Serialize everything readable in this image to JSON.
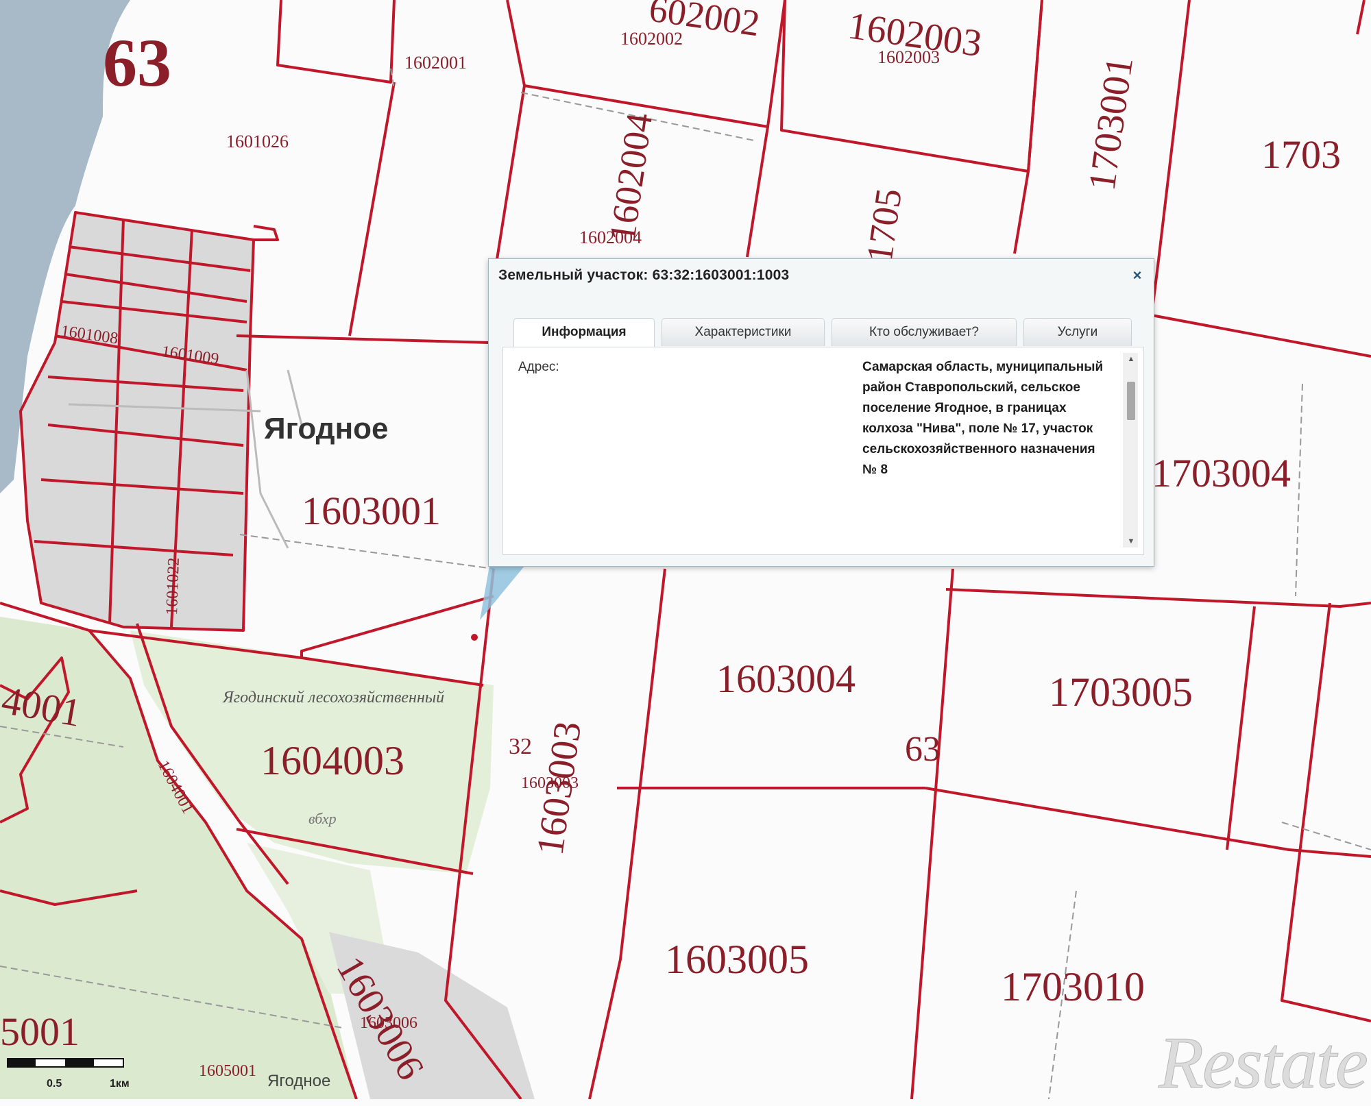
{
  "map": {
    "region_labels": [
      "63",
      "63"
    ],
    "block_labels_large": [
      "1603001",
      "1603004",
      "1703005",
      "1604003",
      "1603005",
      "1703010",
      "1703004",
      "1602003",
      "1703001",
      "1603003",
      "1603006",
      "1602004",
      "1705",
      "602002",
      "1703",
      "4001",
      "5001"
    ],
    "block_labels_small": [
      "1602001",
      "1602002",
      "1602003",
      "1601026",
      "1602004",
      "1601008",
      "1601009",
      "1601022",
      "1604001",
      "1603003",
      "1603006",
      "1605001",
      "32"
    ],
    "settlement_label": "Ягодное",
    "settlement_label_small": "Ягодное",
    "forestry_label": "Ягодинский лесохозяйственный",
    "small_note": "вбхр"
  },
  "dialog": {
    "title": "Земельный участок: 63:32:1603001:1003",
    "close_label": "×",
    "tabs": [
      "Информация",
      "Характеристики",
      "Кто обслуживает?",
      "Услуги"
    ],
    "active_tab": 0,
    "field_label": "Адрес:",
    "field_value": "Самарская область, муниципальный район Ставропольский, сельское поселение Ягодное, в границах колхоза \"Нива\", поле № 17, участок сельскохозяйственного назначения № 8"
  },
  "scale": {
    "ticks": [
      "0.5",
      "1км"
    ]
  },
  "watermark": "Restate",
  "colors": {
    "boundary": "#c0182a",
    "label": "#8a1f2a",
    "water": "#a8b9c8",
    "forest": "#e4efd9",
    "forest_dark": "#dbe9cf",
    "built_up": "#d9d9d9",
    "dialog_border": "#9fb7c2"
  }
}
